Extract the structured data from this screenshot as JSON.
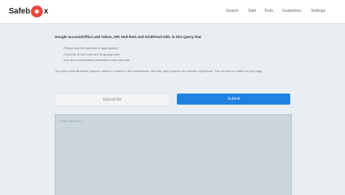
{
  "header": {
    "logo_left": "Safeb",
    "logo_right": "x",
    "nav": [
      "Search",
      "Safe",
      "Tools",
      "Guidelines",
      "Settings"
    ]
  },
  "main": {
    "title": "Google account/Office and Yahoo, ISP, Hull Rich and Kick/Feed with, in this Query that",
    "bullets": [
      "Please add the address (if appropriate)",
      "Contents of the main text (if appropriate)",
      "Any other associated information that may help"
    ],
    "paragraph": "The input code/Browser request, which is related in this submission, will help and improve the overall experience. The content is related to this page.",
    "secondary_button": "Upload file",
    "primary_button": "Submit",
    "editor_placeholder": "Enter text here..."
  },
  "colors": {
    "accent": "#1f82e0",
    "logo": "#e8463f",
    "page_background": "#e9eef3"
  }
}
